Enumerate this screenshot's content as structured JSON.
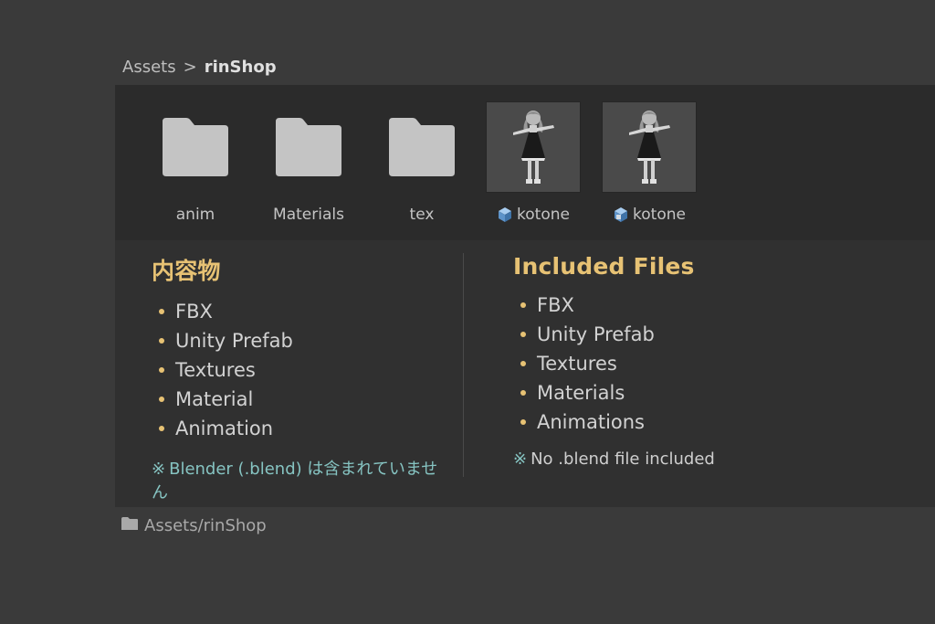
{
  "breadcrumb": {
    "root": "Assets",
    "separator": ">",
    "current": "rinShop"
  },
  "assets": [
    {
      "name": "anim",
      "type": "folder"
    },
    {
      "name": "Materials",
      "type": "folder"
    },
    {
      "name": "tex",
      "type": "folder"
    },
    {
      "name": "kotone",
      "type": "prefab",
      "icon": "prefab-cube-icon"
    },
    {
      "name": "kotone",
      "type": "prefab",
      "icon": "prefab-cube-icon"
    }
  ],
  "info": {
    "left": {
      "heading": "内容物",
      "items": [
        "FBX",
        "Unity Prefab",
        "Textures",
        "Material",
        "Animation"
      ],
      "note_mark": "※",
      "note": "Blender (.blend) は含まれていません"
    },
    "right": {
      "heading": "Included Files",
      "items": [
        "FBX",
        "Unity Prefab",
        "Textures",
        "Materials",
        "Animations"
      ],
      "note_mark": "※",
      "note": "No .blend file included"
    }
  },
  "footer": {
    "path": "Assets/rinShop"
  },
  "colors": {
    "heading": "#e7c274",
    "note": "#86c4c2",
    "panel": "#2b2b2b",
    "background": "#3a3a3a"
  }
}
